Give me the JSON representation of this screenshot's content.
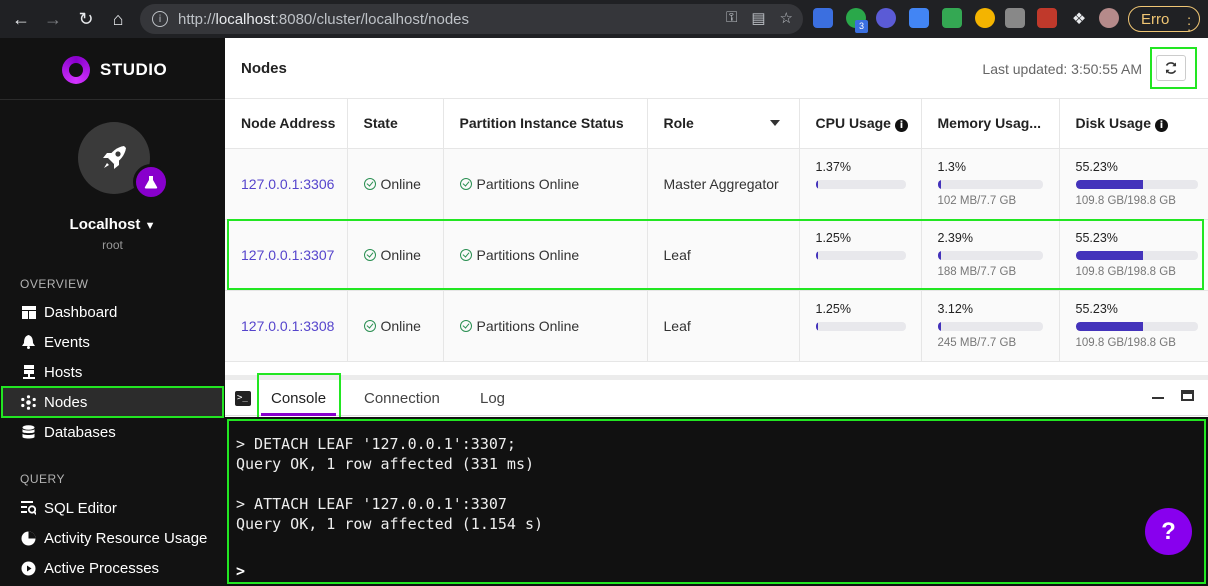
{
  "browser": {
    "url_prefix": "http://",
    "url_host": "localhost",
    "url_rest": ":8080/cluster/localhost/nodes",
    "profile_label": "Erro",
    "ext_badge": "3"
  },
  "sidebar": {
    "brand": "STUDIO",
    "cluster_name": "Localhost",
    "cluster_user": "root",
    "overview_title": "OVERVIEW",
    "query_title": "QUERY",
    "overview_items": [
      {
        "label": "Dashboard",
        "icon": "dashboard-icon"
      },
      {
        "label": "Events",
        "icon": "bell-icon"
      },
      {
        "label": "Hosts",
        "icon": "host-icon"
      },
      {
        "label": "Nodes",
        "icon": "nodes-icon"
      },
      {
        "label": "Databases",
        "icon": "database-icon"
      }
    ],
    "query_items": [
      {
        "label": "SQL Editor",
        "icon": "sql-editor-icon"
      },
      {
        "label": "Activity Resource Usage",
        "icon": "activity-icon"
      },
      {
        "label": "Active Processes",
        "icon": "processes-icon"
      }
    ]
  },
  "header": {
    "title": "Nodes",
    "last_updated": "Last updated: 3:50:55 AM"
  },
  "table": {
    "columns": [
      "Node Address",
      "State",
      "Partition Instance Status",
      "Role",
      "CPU Usage",
      "Memory Usag...",
      "Disk Usage"
    ],
    "rows": [
      {
        "address": "127.0.0.1:3306",
        "state": "Online",
        "partition": "Partitions Online",
        "role": "Master Aggregator",
        "cpu": "1.37%",
        "cpu_frac": 0.0137,
        "mem": "1.3%",
        "mem_frac": 0.013,
        "mem_sub": "102 MB/7.7 GB",
        "disk": "55.23%",
        "disk_frac": 0.5523,
        "disk_sub": "109.8 GB/198.8 GB"
      },
      {
        "address": "127.0.0.1:3307",
        "state": "Online",
        "partition": "Partitions Online",
        "role": "Leaf",
        "cpu": "1.25%",
        "cpu_frac": 0.0125,
        "mem": "2.39%",
        "mem_frac": 0.0239,
        "mem_sub": "188 MB/7.7 GB",
        "disk": "55.23%",
        "disk_frac": 0.5523,
        "disk_sub": "109.8 GB/198.8 GB"
      },
      {
        "address": "127.0.0.1:3308",
        "state": "Online",
        "partition": "Partitions Online",
        "role": "Leaf",
        "cpu": "1.25%",
        "cpu_frac": 0.0125,
        "mem": "3.12%",
        "mem_frac": 0.0312,
        "mem_sub": "245 MB/7.7 GB",
        "disk": "55.23%",
        "disk_frac": 0.5523,
        "disk_sub": "109.8 GB/198.8 GB"
      }
    ]
  },
  "console": {
    "tabs": [
      "Console",
      "Connection",
      "Log"
    ],
    "lines": [
      "> DETACH LEAF '127.0.0.1':3307;",
      "Query OK, 1 row affected (331 ms)",
      "",
      "> ATTACH LEAF '127.0.0.1':3307",
      "Query OK, 1 row affected (1.154 s)"
    ],
    "prompt": ">",
    "help": "?"
  },
  "colors": {
    "accent": "#8800cc",
    "bar_fill": "#4433bb",
    "link": "#5544cc",
    "highlight": "#22e622",
    "online": "#2a8f52"
  }
}
